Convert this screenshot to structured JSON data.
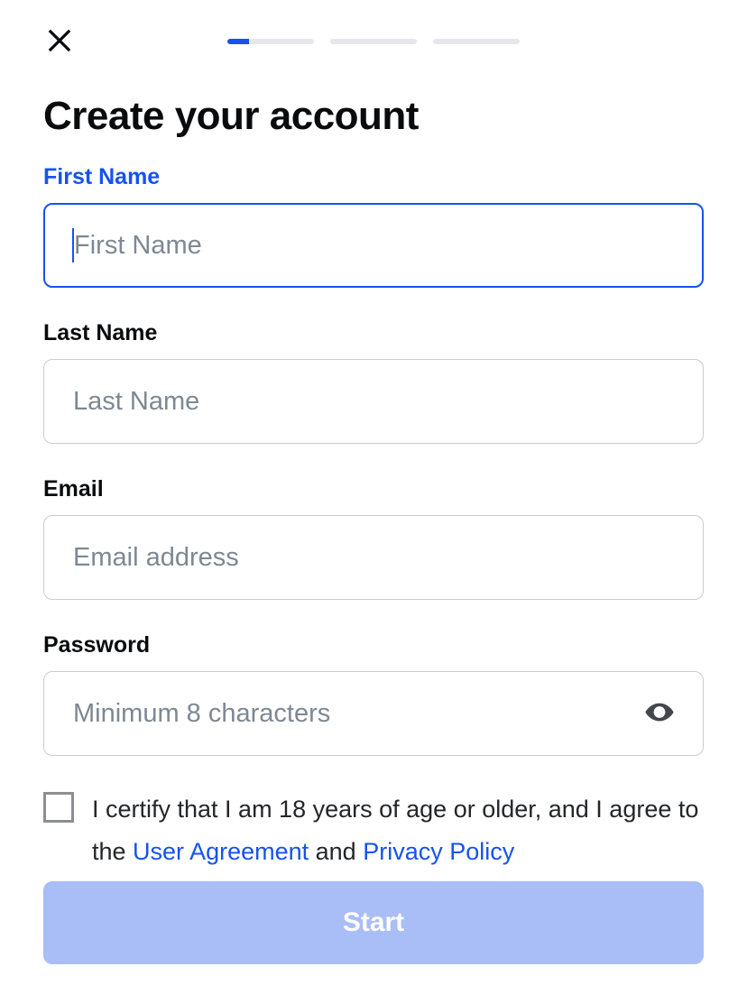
{
  "colors": {
    "accent": "#1652f0",
    "progress_empty": "#e5e7ec",
    "placeholder": "#7e8893",
    "button_disabled_bg": "#a9bdf6"
  },
  "progress": {
    "steps": 3,
    "current_fill_percent": 25
  },
  "title": "Create your account",
  "fields": {
    "first_name": {
      "label": "First Name",
      "placeholder": "First Name",
      "value": "",
      "focused": true
    },
    "last_name": {
      "label": "Last Name",
      "placeholder": "Last Name",
      "value": ""
    },
    "email": {
      "label": "Email",
      "placeholder": "Email address",
      "value": ""
    },
    "password": {
      "label": "Password",
      "placeholder": "Minimum 8 characters",
      "value": ""
    }
  },
  "consent": {
    "text_prefix": "I certify that I am 18 years of age or older, and I agree to the ",
    "link1": "User Agreement",
    "mid": " and ",
    "link2": "Privacy Policy"
  },
  "start_button": "Start"
}
